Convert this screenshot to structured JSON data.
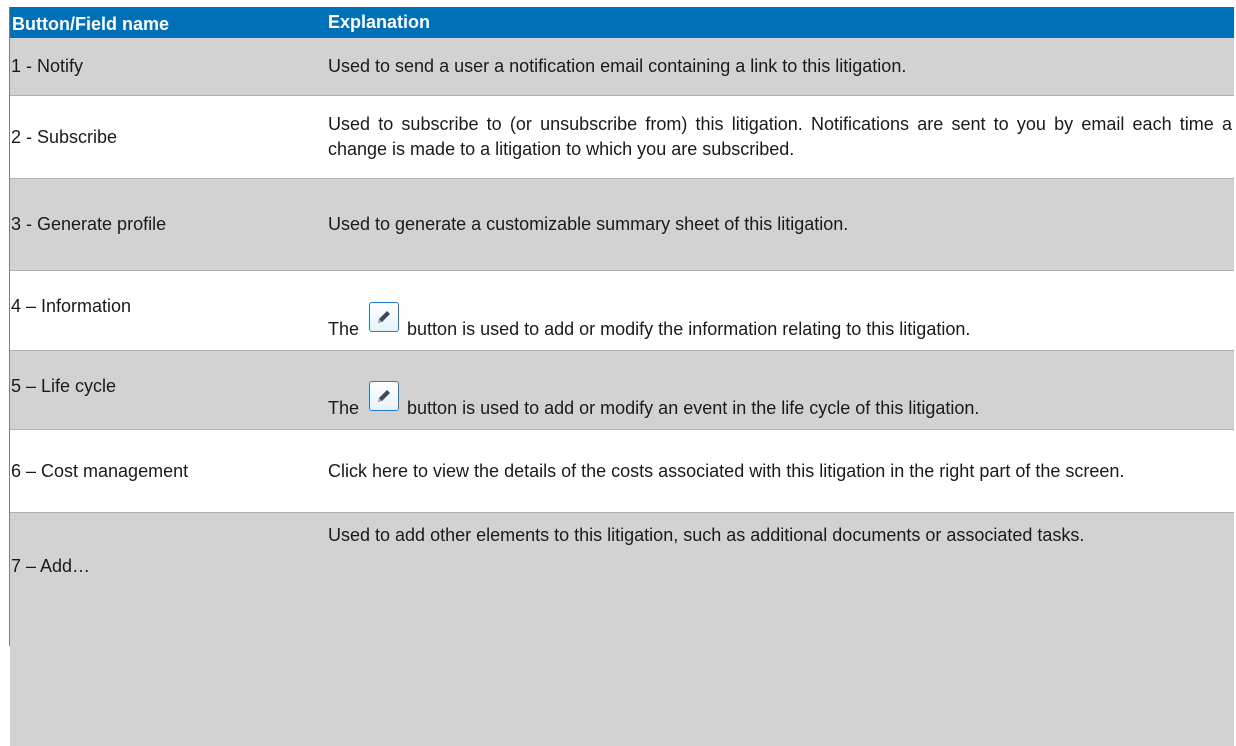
{
  "table": {
    "headers": {
      "name": "Button/Field name",
      "explanation": "Explanation"
    },
    "rows": [
      {
        "name": "1 - Notify",
        "explanation": "Used to send a user a notification email containing a link to this litigation."
      },
      {
        "name": "2 - Subscribe",
        "explanation": "Used to subscribe to (or unsubscribe from) this litigation. Notifications are sent to you by email each time a change is made to a litigation to which you are subscribed."
      },
      {
        "name": "3 - Generate profile",
        "explanation": "Used to generate a customizable summary sheet of this litigation."
      },
      {
        "name": "4 – Information",
        "explanation_prefix": "The",
        "explanation_suffix": "button is used to add or modify the information relating to this litigation."
      },
      {
        "name": "5 – Life cycle",
        "explanation_prefix": "The",
        "explanation_suffix": "button is used to add or modify an event in the life cycle of this litigation."
      },
      {
        "name": "6 – Cost management",
        "explanation": "Click here to view the details of the costs associated with this litigation in the right part of the screen."
      },
      {
        "name": "7 – Add…",
        "explanation": "Used to add other elements to this litigation, such as additional documents or associated tasks."
      }
    ],
    "icon": "pencil-edit-icon",
    "colors": {
      "header": "#0070b8",
      "shaded_row": "#d2d2d2"
    }
  }
}
